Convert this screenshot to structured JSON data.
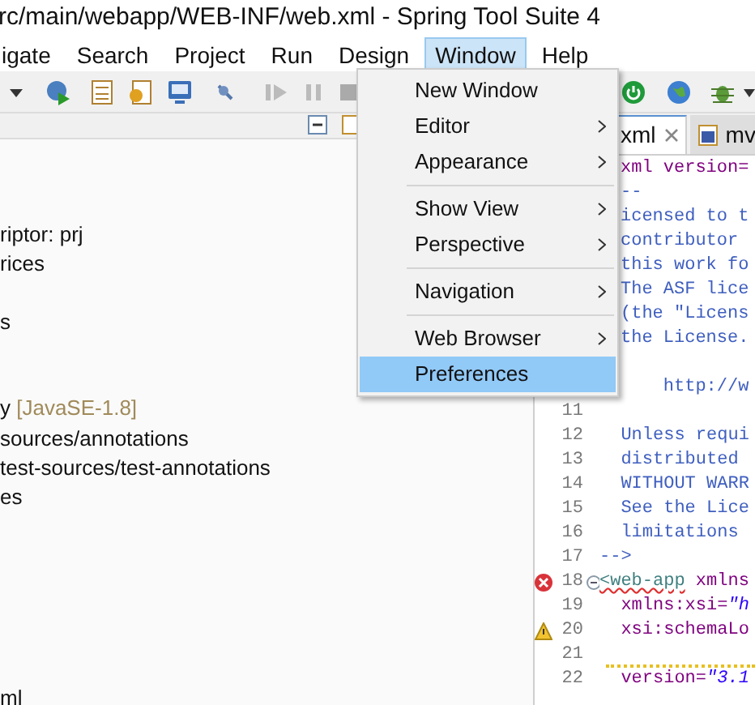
{
  "window": {
    "title": "rc/main/webapp/WEB-INF/web.xml - Spring Tool Suite 4"
  },
  "menu_bar": [
    {
      "label": "igate",
      "selected": false
    },
    {
      "label": "Search",
      "selected": false
    },
    {
      "label": "Project",
      "selected": false
    },
    {
      "label": "Run",
      "selected": false
    },
    {
      "label": "Design",
      "selected": false
    },
    {
      "label": "Window",
      "selected": true
    },
    {
      "label": "Help",
      "selected": false
    }
  ],
  "window_menu": [
    {
      "kind": "item",
      "label": "New Window",
      "submenu": false,
      "selected": false
    },
    {
      "kind": "item",
      "label": "Editor",
      "submenu": true,
      "selected": false
    },
    {
      "kind": "item",
      "label": "Appearance",
      "submenu": true,
      "selected": false
    },
    {
      "kind": "separator"
    },
    {
      "kind": "item",
      "label": "Show View",
      "submenu": true,
      "selected": false
    },
    {
      "kind": "item",
      "label": "Perspective",
      "submenu": true,
      "selected": false
    },
    {
      "kind": "separator"
    },
    {
      "kind": "item",
      "label": "Navigation",
      "submenu": true,
      "selected": false
    },
    {
      "kind": "separator"
    },
    {
      "kind": "item",
      "label": "Web Browser",
      "submenu": true,
      "selected": false
    },
    {
      "kind": "item",
      "label": "Preferences",
      "submenu": false,
      "selected": true
    }
  ],
  "project_tree": [
    {
      "label": "riptor: prj"
    },
    {
      "label": "rices"
    },
    {
      "label": "s"
    },
    {
      "label": "y",
      "note": "[JavaSE-1.8]"
    },
    {
      "label": "sources/annotations"
    },
    {
      "label": "test-sources/test-annotations"
    },
    {
      "label": "es"
    },
    {
      "label": "ml"
    }
  ],
  "editor_tabs": [
    {
      "label": "xml",
      "selected": true,
      "closable": true
    },
    {
      "label": "mv",
      "selected": false
    }
  ],
  "editor_lines": [
    {
      "segments": [
        {
          "text": "xml version=",
          "kind": "attr"
        }
      ]
    },
    {
      "segments": [
        {
          "text": "--",
          "kind": "comment"
        }
      ]
    },
    {
      "segments": [
        {
          "text": "icensed to t",
          "kind": "comment"
        }
      ]
    },
    {
      "segments": [
        {
          "text": "contributor",
          "kind": "comment"
        }
      ]
    },
    {
      "segments": [
        {
          "text": "this work fo",
          "kind": "comment"
        }
      ]
    },
    {
      "segments": [
        {
          "text": "The ASF lice",
          "kind": "comment"
        }
      ]
    },
    {
      "segments": [
        {
          "text": "(the \"Licens",
          "kind": "comment"
        }
      ]
    },
    {
      "segments": [
        {
          "text": "the License.",
          "kind": "comment"
        }
      ]
    },
    {
      "kind": "blank"
    },
    {
      "segments": [
        {
          "text": "    http://w",
          "kind": "comment"
        }
      ]
    },
    {
      "number": "11"
    },
    {
      "number": "12",
      "segments": [
        {
          "text": "  Unless requi",
          "kind": "comment"
        }
      ]
    },
    {
      "number": "13",
      "segments": [
        {
          "text": "  distributed",
          "kind": "comment"
        }
      ]
    },
    {
      "number": "14",
      "segments": [
        {
          "text": "  WITHOUT WARR",
          "kind": "comment"
        }
      ]
    },
    {
      "number": "15",
      "segments": [
        {
          "text": "  See the Lice",
          "kind": "comment"
        }
      ]
    },
    {
      "number": "16",
      "segments": [
        {
          "text": "  limitations",
          "kind": "comment"
        }
      ]
    },
    {
      "number": "17",
      "segments": [
        {
          "text": "-->",
          "kind": "comment"
        }
      ]
    },
    {
      "number": "18",
      "error": true,
      "foldable": true,
      "segments": [
        {
          "text": "<web-app",
          "kind": "tag",
          "squiggle": true
        },
        {
          "text": " xmlns",
          "kind": "attr"
        }
      ]
    },
    {
      "number": "19",
      "segments": [
        {
          "text": "  xmlns:xsi=",
          "kind": "attr"
        },
        {
          "text": "\"h",
          "kind": "string"
        }
      ]
    },
    {
      "number": "20",
      "warning": true,
      "segments": [
        {
          "text": "  xsi:schemaLo",
          "kind": "attr"
        }
      ]
    },
    {
      "number": "21",
      "warning_underline": true
    },
    {
      "number": "22",
      "segments": [
        {
          "text": "  version=",
          "kind": "attr"
        },
        {
          "text": "\"3.1",
          "kind": "string"
        }
      ]
    }
  ]
}
